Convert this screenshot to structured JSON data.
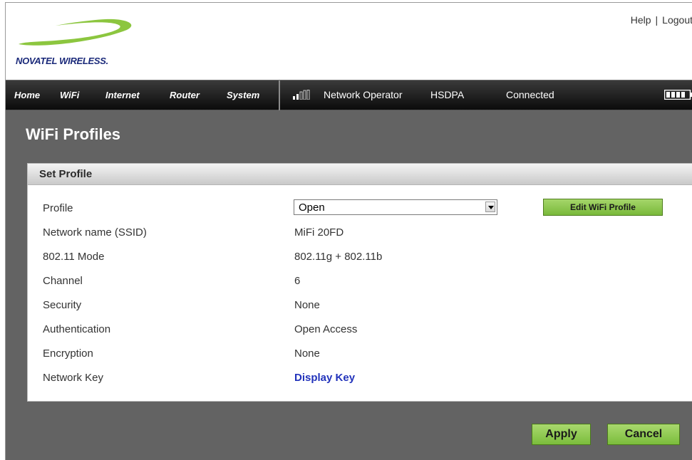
{
  "header": {
    "logo_text": "NOVATEL WIRELESS.",
    "links": [
      "Help",
      "Logout"
    ],
    "separator": "|"
  },
  "nav": {
    "items": [
      "Home",
      "WiFi",
      "Internet",
      "Router",
      "System"
    ]
  },
  "status": {
    "signal_icon": "signal-bars-icon",
    "operator": "Network Operator",
    "technology": "HSDPA",
    "connection": "Connected",
    "battery_icon": "battery-icon"
  },
  "page": {
    "title": "WiFi Profiles"
  },
  "panel": {
    "title": "Set Profile",
    "profile_label": "Profile",
    "profile_value": "Open",
    "edit_button": "Edit WiFi Profile",
    "rows": [
      {
        "label": "Network name (SSID)",
        "value": "MiFi 20FD"
      },
      {
        "label": "802.11 Mode",
        "value": "802.11g + 802.11b"
      },
      {
        "label": "Channel",
        "value": "6"
      },
      {
        "label": "Security",
        "value": "None"
      },
      {
        "label": "Authentication",
        "value": "Open Access"
      },
      {
        "label": "Encryption",
        "value": "None"
      }
    ],
    "network_key_label": "Network Key",
    "network_key_link": "Display Key"
  },
  "actions": {
    "apply": "Apply",
    "cancel": "Cancel"
  },
  "colors": {
    "accent_green": "#8cc84b",
    "content_bg": "#636363",
    "link_blue": "#2233bb",
    "logo_green": "#8cc63f",
    "logo_blue": "#1b2a7a"
  }
}
